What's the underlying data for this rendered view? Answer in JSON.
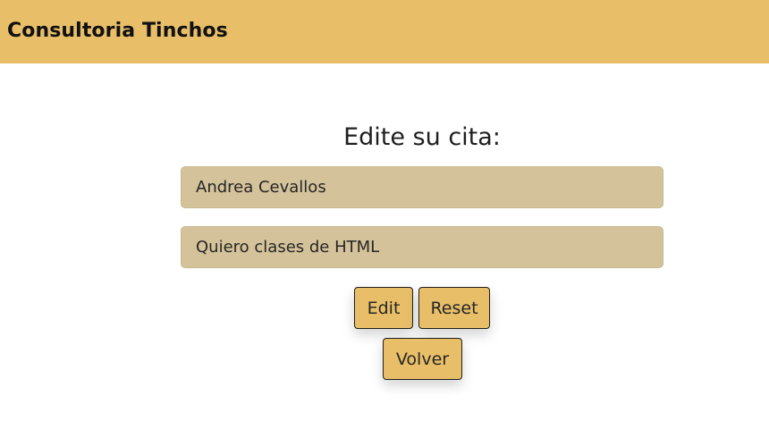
{
  "navbar": {
    "brand": "Consultoria Tinchos"
  },
  "form": {
    "heading": "Edite su cita:",
    "name_value": "Andrea Cevallos",
    "reason_value": "Quiero clases de HTML",
    "edit_label": "Edit",
    "reset_label": "Reset",
    "back_label": "Volver"
  },
  "colors": {
    "accent": "#e8bf68",
    "field_background": "#d4c29a"
  }
}
